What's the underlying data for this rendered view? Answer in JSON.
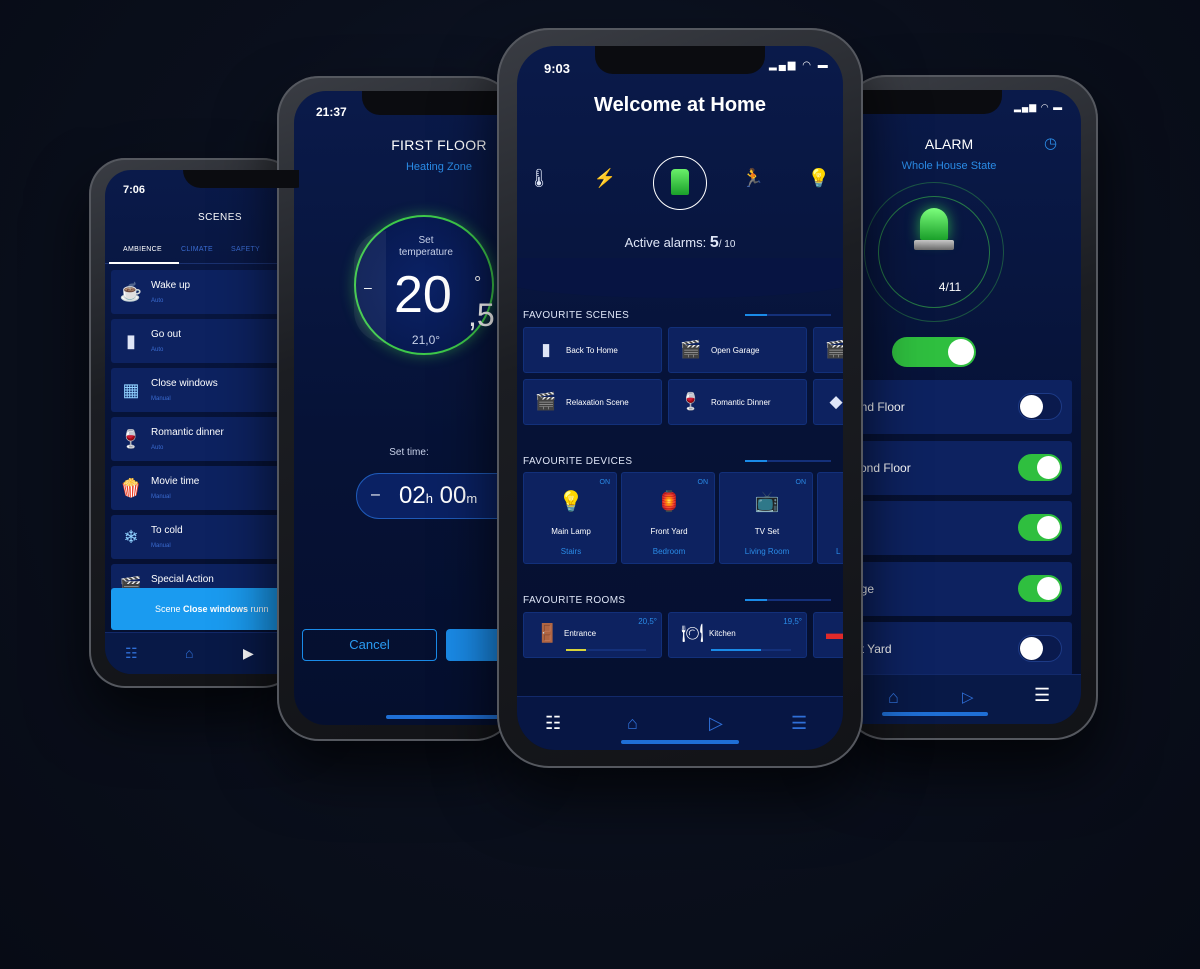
{
  "colors": {
    "accent": "#1a8be8",
    "green": "#2fbf3f",
    "screen_bg": "#061236",
    "card_bg": "#0d2260"
  },
  "scenes_phone": {
    "time": "7:06",
    "title": "SCENES",
    "tabs": [
      "AMBIENCE",
      "CLIMATE",
      "SAFETY"
    ],
    "items": [
      {
        "name": "Wake up",
        "mode": "Auto",
        "icon": "coffee-icon"
      },
      {
        "name": "Go out",
        "mode": "Auto",
        "icon": "door-icon"
      },
      {
        "name": "Close windows",
        "mode": "Manual",
        "icon": "window-icon"
      },
      {
        "name": "Romantic dinner",
        "mode": "Auto",
        "icon": "wine-icon"
      },
      {
        "name": "Movie time",
        "mode": "Manual",
        "icon": "popcorn-icon"
      },
      {
        "name": "To cold",
        "mode": "Manual",
        "icon": "snowflake-icon"
      },
      {
        "name": "Special Action",
        "mode": "",
        "icon": "clapper-icon"
      }
    ],
    "toast_prefix": "Scene ",
    "toast_bold": "Close windows",
    "toast_suffix": " runn"
  },
  "heating_phone": {
    "time": "21:37",
    "title": "FIRST FLOOR",
    "subtitle": "Heating Zone",
    "set_label": "Set temperature",
    "set_int": "20",
    "set_dec": ",5",
    "degree": "°",
    "current": "21,0°",
    "minus": "–",
    "set_time_label": "Set time:",
    "time_hours": "02",
    "time_h_unit": "h",
    "time_minutes": "00",
    "time_m_unit": "m",
    "cancel": "Cancel"
  },
  "home_phone": {
    "time": "9:03",
    "title": "Welcome at Home",
    "categories": [
      "thermometer-icon",
      "lightning-icon",
      "alarm-icon",
      "running-man-icon",
      "bulb-icon"
    ],
    "active_label": "Active alarms:",
    "active_count": "5",
    "active_total": "/ 10",
    "scenes_header": "FAVOURITE SCENES",
    "scenes": [
      {
        "name": "Back To Home",
        "icon": "door-icon"
      },
      {
        "name": "Open Garage",
        "icon": "clapper-icon"
      },
      {
        "name": "Relaxation Scene",
        "icon": "clapper-icon"
      },
      {
        "name": "Romantic Dinner",
        "icon": "wine-icon"
      }
    ],
    "devices_header": "FAVOURITE DEVICES",
    "devices": [
      {
        "name": "Main Lamp",
        "room": "Stairs",
        "state": "ON",
        "icon": "bulb-icon"
      },
      {
        "name": "Front Yard",
        "room": "Bedroom",
        "state": "ON",
        "icon": "garden-lamp-icon"
      },
      {
        "name": "TV Set",
        "room": "Living Room",
        "state": "ON",
        "icon": "tv-icon"
      }
    ],
    "device_partial_room": "L",
    "rooms_header": "FAVOURITE ROOMS",
    "rooms": [
      {
        "name": "Entrance",
        "temp": "20,5°",
        "icon": "door-icon",
        "level": 0.25,
        "color": "#d8d43a"
      },
      {
        "name": "Kitchen",
        "temp": "19,5°",
        "icon": "plate-icon",
        "level": 0.62,
        "color": "#1a8be8"
      }
    ]
  },
  "alarm_phone": {
    "title": "ALARM",
    "subtitle": "Whole House State",
    "count": "4/11",
    "zones": [
      {
        "label": "und Floor",
        "on": false
      },
      {
        "label": "cond Floor",
        "on": true
      },
      {
        "label": "c",
        "on": true
      },
      {
        "label": "age",
        "on": true
      },
      {
        "label": "nt Yard",
        "on": false
      }
    ]
  }
}
